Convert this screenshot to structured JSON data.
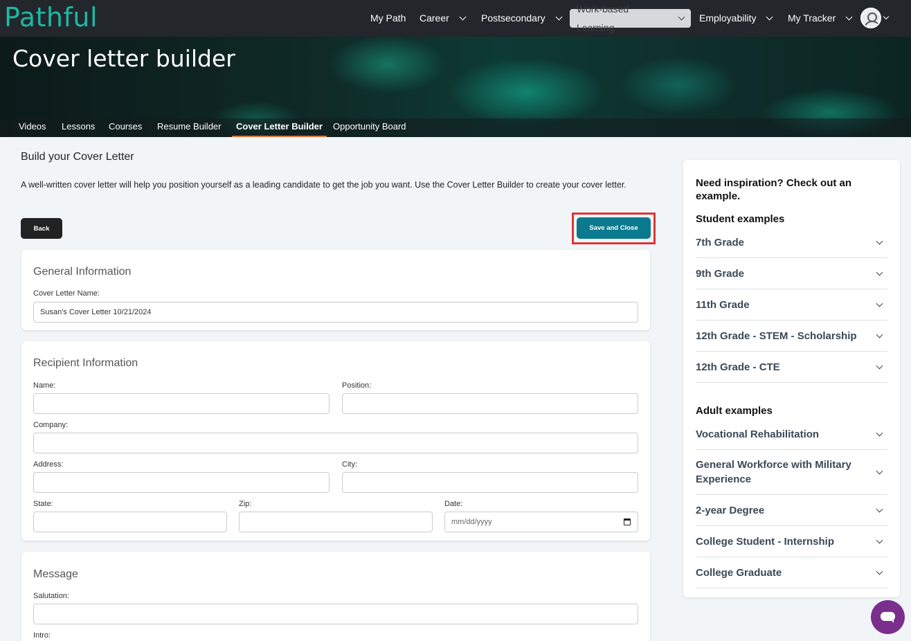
{
  "header": {
    "logo": "Pathful",
    "nav": [
      {
        "label": "My Path",
        "dropdown": false
      },
      {
        "label": "Career",
        "dropdown": true
      },
      {
        "label": "Postsecondary",
        "dropdown": true
      },
      {
        "label": "Work-based Learning",
        "dropdown": true,
        "active": true
      },
      {
        "label": "Employability",
        "dropdown": true
      },
      {
        "label": "My Tracker",
        "dropdown": true
      }
    ]
  },
  "hero": {
    "title": "Cover letter builder",
    "tabs": [
      "Videos",
      "Lessons",
      "Courses",
      "Resume Builder",
      "Cover Letter Builder",
      "Opportunity Board"
    ],
    "active_tab": "Cover Letter Builder"
  },
  "main": {
    "heading": "Build your Cover Letter",
    "intro": "A well-written cover letter will help you position yourself as a leading candidate to get the job you want. Use the Cover Letter Builder to create your cover letter.",
    "back_label": "Back",
    "save_label": "Save and Close"
  },
  "general": {
    "title": "General Information",
    "name_label": "Cover Letter Name:",
    "name_value": "Susan's Cover Letter 10/21/2024"
  },
  "recipient": {
    "title": "Recipient Information",
    "name_label": "Name:",
    "position_label": "Position:",
    "company_label": "Company:",
    "address_label": "Address:",
    "city_label": "City:",
    "state_label": "State:",
    "zip_label": "Zip:",
    "date_label": "Date:",
    "date_placeholder": "mm/dd/yyyy"
  },
  "message": {
    "title": "Message",
    "salutation_label": "Salutation:",
    "intro_label": "Intro:"
  },
  "sidebar": {
    "heading": "Need inspiration? Check out an example.",
    "student_heading": "Student examples",
    "student_items": [
      "7th Grade",
      "9th Grade",
      "11th Grade",
      "12th Grade - STEM - Scholarship",
      "12th Grade - CTE"
    ],
    "adult_heading": "Adult examples",
    "adult_items": [
      "Vocational Rehabilitation",
      "General Workforce with Military Experience",
      "2-year Degree",
      "College Student - Internship",
      "College Graduate"
    ]
  },
  "colors": {
    "nav_bg": "#23262b",
    "brand": "#1bb9a4",
    "save_button": "#0b7a8f",
    "highlight": "#e03434",
    "chat": "#7a2f8c",
    "active_tab_underline": "#e0703a"
  }
}
